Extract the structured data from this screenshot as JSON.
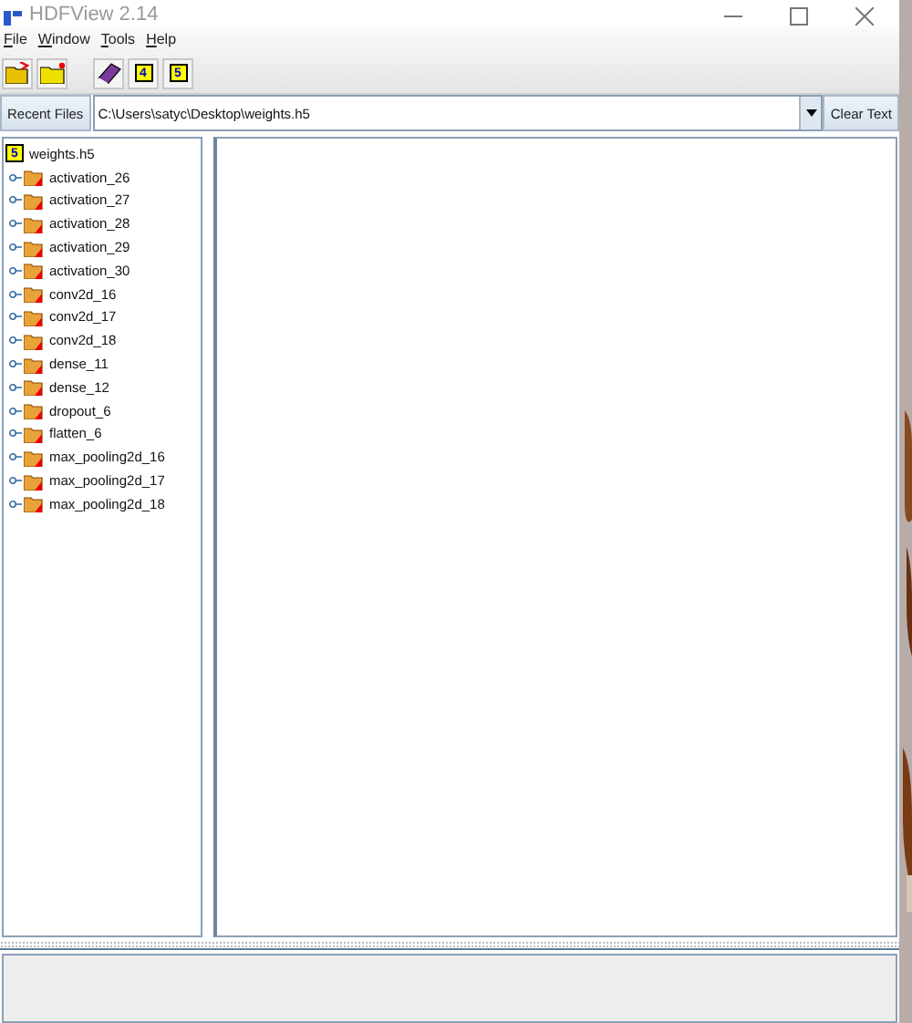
{
  "window": {
    "title": "HDFView 2.14"
  },
  "menu": [
    "File",
    "Window",
    "Tools",
    "Help"
  ],
  "toolbar": [
    {
      "kind": "open"
    },
    {
      "kind": "new"
    },
    {
      "kind": "book"
    },
    {
      "kind": "h4"
    },
    {
      "kind": "h5"
    }
  ],
  "toolbar_labels": {
    "h4": "4",
    "h5": "5"
  },
  "recent_files": {
    "label": "Recent Files",
    "value": "C:\\Users\\satyc\\Desktop\\weights.h5",
    "clear": "Clear Text"
  },
  "tree": {
    "root": {
      "label": "weights.h5",
      "badge": "5"
    },
    "children": [
      {
        "label": "activation_26"
      },
      {
        "label": "activation_27"
      },
      {
        "label": "activation_28"
      },
      {
        "label": "activation_29"
      },
      {
        "label": "activation_30"
      },
      {
        "label": "conv2d_16"
      },
      {
        "label": "conv2d_17"
      },
      {
        "label": "conv2d_18"
      },
      {
        "label": "dense_11"
      },
      {
        "label": "dense_12"
      },
      {
        "label": "dropout_6"
      },
      {
        "label": "flatten_6"
      },
      {
        "label": "max_pooling2d_16"
      },
      {
        "label": "max_pooling2d_17"
      },
      {
        "label": "max_pooling2d_18"
      }
    ]
  }
}
